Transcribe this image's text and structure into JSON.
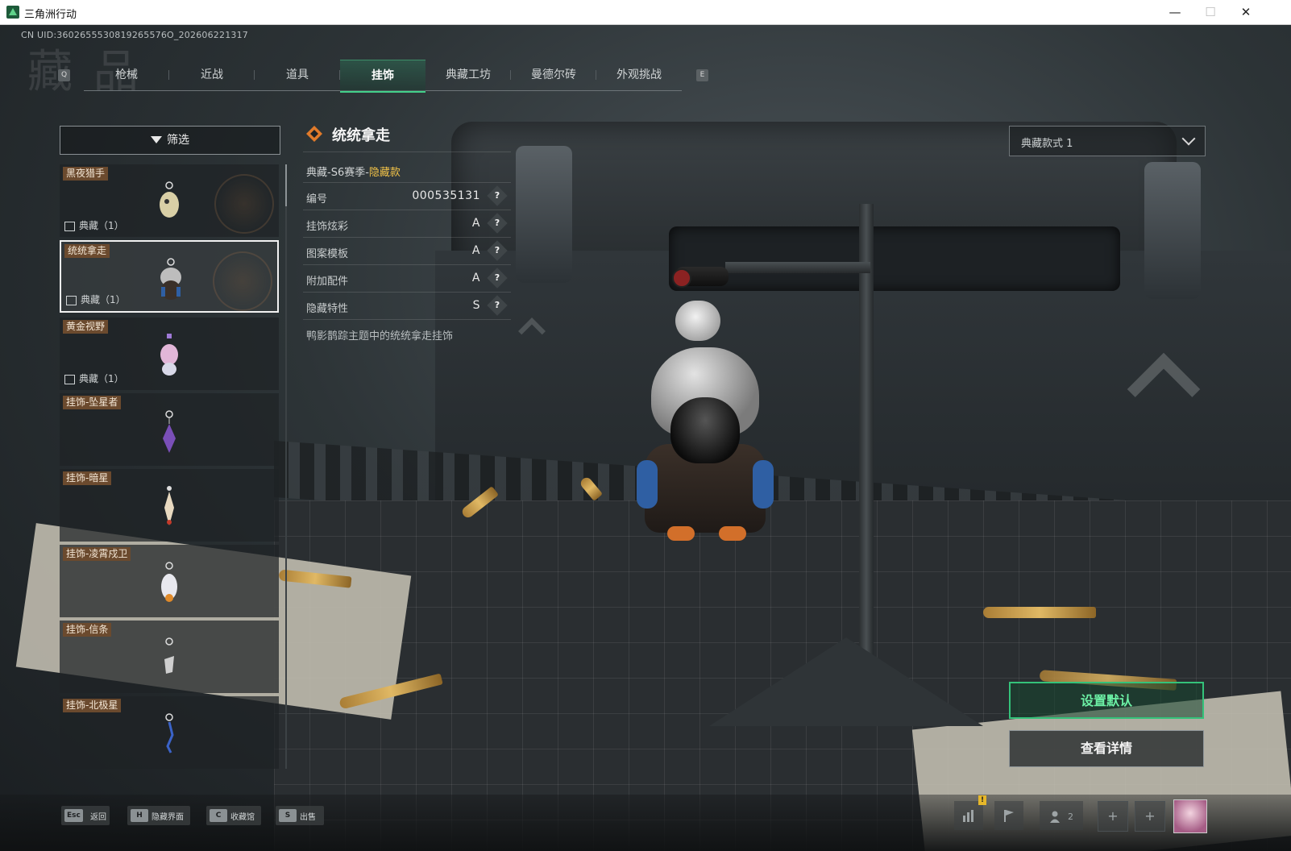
{
  "window": {
    "title": "三角洲行动",
    "minimize": "—",
    "maximize": "☐",
    "close": "✕"
  },
  "uid": "CN UID:3602655530819265576O_202606221317",
  "watermark": "藏 品",
  "tabs": {
    "prev_key": "Q",
    "next_key": "E",
    "items": [
      {
        "label": "枪械"
      },
      {
        "label": "近战"
      },
      {
        "label": "道具"
      },
      {
        "label": "挂饰",
        "active": true
      },
      {
        "label": "典藏工坊"
      },
      {
        "label": "曼德尔砖"
      },
      {
        "label": "外观挑战"
      }
    ]
  },
  "filter": {
    "label": "筛选"
  },
  "list": {
    "items": [
      {
        "name": "黑夜猎手",
        "collection": "典藏（1）"
      },
      {
        "name": "统统拿走",
        "collection": "典藏（1）",
        "selected": true
      },
      {
        "name": "黄金视野",
        "collection": "典藏（1）"
      },
      {
        "name": "挂饰-坠星者",
        "collection": ""
      },
      {
        "name": "挂饰-暗星",
        "collection": ""
      },
      {
        "name": "挂饰-凌霄戍卫",
        "collection": ""
      },
      {
        "name": "挂饰-信条",
        "collection": ""
      },
      {
        "name": "挂饰-北极星",
        "collection": ""
      }
    ]
  },
  "detail": {
    "title": "统统拿走",
    "subtitle_prefix": "典藏-S6赛季-",
    "subtitle_highlight": "隐藏款",
    "attributes": [
      {
        "key": "编号",
        "value": "000535131"
      },
      {
        "key": "挂饰炫彩",
        "value": "A"
      },
      {
        "key": "图案模板",
        "value": "A"
      },
      {
        "key": "附加配件",
        "value": "A"
      },
      {
        "key": "隐藏特性",
        "value": "S"
      }
    ],
    "help_glyph": "?",
    "description": "鸭影鹊踪主题中的统统拿走挂饰"
  },
  "style_select": {
    "value": "典藏款式 1"
  },
  "buttons": {
    "set_default": "设置默认",
    "view_details": "查看详情"
  },
  "bottom_hints": [
    {
      "key": "Esc",
      "label": "返回"
    },
    {
      "key": "H",
      "label": "隐藏界面"
    },
    {
      "key": "C",
      "label": "收藏馆"
    },
    {
      "key": "S",
      "label": "出售"
    }
  ],
  "bottom_right": {
    "badge": "!",
    "party_count": "2",
    "plus": "+"
  },
  "colors": {
    "accent_green": "#34c27a",
    "highlight_gold": "#f1c248",
    "name_tag_brown": "#6b4a2e"
  },
  "icons": {
    "app": "delta-force-logo-icon",
    "filter": "funnel-icon",
    "collection": "collection-mini-icon",
    "item_header": "diamond-emblem-icon",
    "help": "question-diamond-icon",
    "dropdown": "chevron-down-icon",
    "stats": "bar-chart-icon",
    "flag": "flag-icon",
    "party": "people-icon"
  }
}
